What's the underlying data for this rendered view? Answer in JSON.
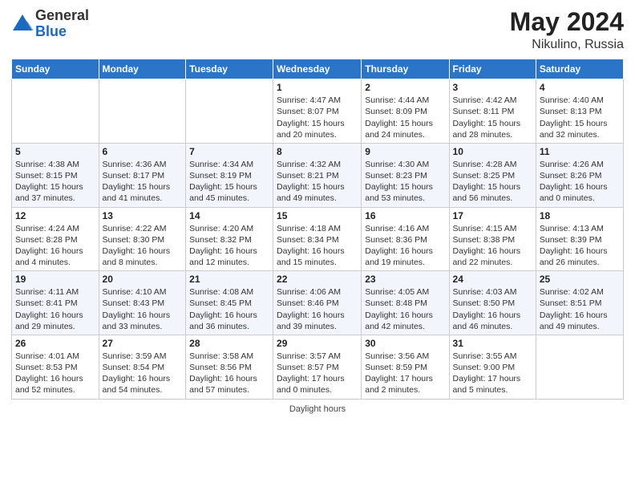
{
  "header": {
    "logo_general": "General",
    "logo_blue": "Blue",
    "month_year": "May 2024",
    "location": "Nikulino, Russia"
  },
  "days_of_week": [
    "Sunday",
    "Monday",
    "Tuesday",
    "Wednesday",
    "Thursday",
    "Friday",
    "Saturday"
  ],
  "weeks": [
    [
      {
        "day": "",
        "info": ""
      },
      {
        "day": "",
        "info": ""
      },
      {
        "day": "",
        "info": ""
      },
      {
        "day": "1",
        "info": "Sunrise: 4:47 AM\nSunset: 8:07 PM\nDaylight: 15 hours\nand 20 minutes."
      },
      {
        "day": "2",
        "info": "Sunrise: 4:44 AM\nSunset: 8:09 PM\nDaylight: 15 hours\nand 24 minutes."
      },
      {
        "day": "3",
        "info": "Sunrise: 4:42 AM\nSunset: 8:11 PM\nDaylight: 15 hours\nand 28 minutes."
      },
      {
        "day": "4",
        "info": "Sunrise: 4:40 AM\nSunset: 8:13 PM\nDaylight: 15 hours\nand 32 minutes."
      }
    ],
    [
      {
        "day": "5",
        "info": "Sunrise: 4:38 AM\nSunset: 8:15 PM\nDaylight: 15 hours\nand 37 minutes."
      },
      {
        "day": "6",
        "info": "Sunrise: 4:36 AM\nSunset: 8:17 PM\nDaylight: 15 hours\nand 41 minutes."
      },
      {
        "day": "7",
        "info": "Sunrise: 4:34 AM\nSunset: 8:19 PM\nDaylight: 15 hours\nand 45 minutes."
      },
      {
        "day": "8",
        "info": "Sunrise: 4:32 AM\nSunset: 8:21 PM\nDaylight: 15 hours\nand 49 minutes."
      },
      {
        "day": "9",
        "info": "Sunrise: 4:30 AM\nSunset: 8:23 PM\nDaylight: 15 hours\nand 53 minutes."
      },
      {
        "day": "10",
        "info": "Sunrise: 4:28 AM\nSunset: 8:25 PM\nDaylight: 15 hours\nand 56 minutes."
      },
      {
        "day": "11",
        "info": "Sunrise: 4:26 AM\nSunset: 8:26 PM\nDaylight: 16 hours\nand 0 minutes."
      }
    ],
    [
      {
        "day": "12",
        "info": "Sunrise: 4:24 AM\nSunset: 8:28 PM\nDaylight: 16 hours\nand 4 minutes."
      },
      {
        "day": "13",
        "info": "Sunrise: 4:22 AM\nSunset: 8:30 PM\nDaylight: 16 hours\nand 8 minutes."
      },
      {
        "day": "14",
        "info": "Sunrise: 4:20 AM\nSunset: 8:32 PM\nDaylight: 16 hours\nand 12 minutes."
      },
      {
        "day": "15",
        "info": "Sunrise: 4:18 AM\nSunset: 8:34 PM\nDaylight: 16 hours\nand 15 minutes."
      },
      {
        "day": "16",
        "info": "Sunrise: 4:16 AM\nSunset: 8:36 PM\nDaylight: 16 hours\nand 19 minutes."
      },
      {
        "day": "17",
        "info": "Sunrise: 4:15 AM\nSunset: 8:38 PM\nDaylight: 16 hours\nand 22 minutes."
      },
      {
        "day": "18",
        "info": "Sunrise: 4:13 AM\nSunset: 8:39 PM\nDaylight: 16 hours\nand 26 minutes."
      }
    ],
    [
      {
        "day": "19",
        "info": "Sunrise: 4:11 AM\nSunset: 8:41 PM\nDaylight: 16 hours\nand 29 minutes."
      },
      {
        "day": "20",
        "info": "Sunrise: 4:10 AM\nSunset: 8:43 PM\nDaylight: 16 hours\nand 33 minutes."
      },
      {
        "day": "21",
        "info": "Sunrise: 4:08 AM\nSunset: 8:45 PM\nDaylight: 16 hours\nand 36 minutes."
      },
      {
        "day": "22",
        "info": "Sunrise: 4:06 AM\nSunset: 8:46 PM\nDaylight: 16 hours\nand 39 minutes."
      },
      {
        "day": "23",
        "info": "Sunrise: 4:05 AM\nSunset: 8:48 PM\nDaylight: 16 hours\nand 42 minutes."
      },
      {
        "day": "24",
        "info": "Sunrise: 4:03 AM\nSunset: 8:50 PM\nDaylight: 16 hours\nand 46 minutes."
      },
      {
        "day": "25",
        "info": "Sunrise: 4:02 AM\nSunset: 8:51 PM\nDaylight: 16 hours\nand 49 minutes."
      }
    ],
    [
      {
        "day": "26",
        "info": "Sunrise: 4:01 AM\nSunset: 8:53 PM\nDaylight: 16 hours\nand 52 minutes."
      },
      {
        "day": "27",
        "info": "Sunrise: 3:59 AM\nSunset: 8:54 PM\nDaylight: 16 hours\nand 54 minutes."
      },
      {
        "day": "28",
        "info": "Sunrise: 3:58 AM\nSunset: 8:56 PM\nDaylight: 16 hours\nand 57 minutes."
      },
      {
        "day": "29",
        "info": "Sunrise: 3:57 AM\nSunset: 8:57 PM\nDaylight: 17 hours\nand 0 minutes."
      },
      {
        "day": "30",
        "info": "Sunrise: 3:56 AM\nSunset: 8:59 PM\nDaylight: 17 hours\nand 2 minutes."
      },
      {
        "day": "31",
        "info": "Sunrise: 3:55 AM\nSunset: 9:00 PM\nDaylight: 17 hours\nand 5 minutes."
      },
      {
        "day": "",
        "info": ""
      }
    ]
  ],
  "footer": {
    "note": "Daylight hours"
  }
}
